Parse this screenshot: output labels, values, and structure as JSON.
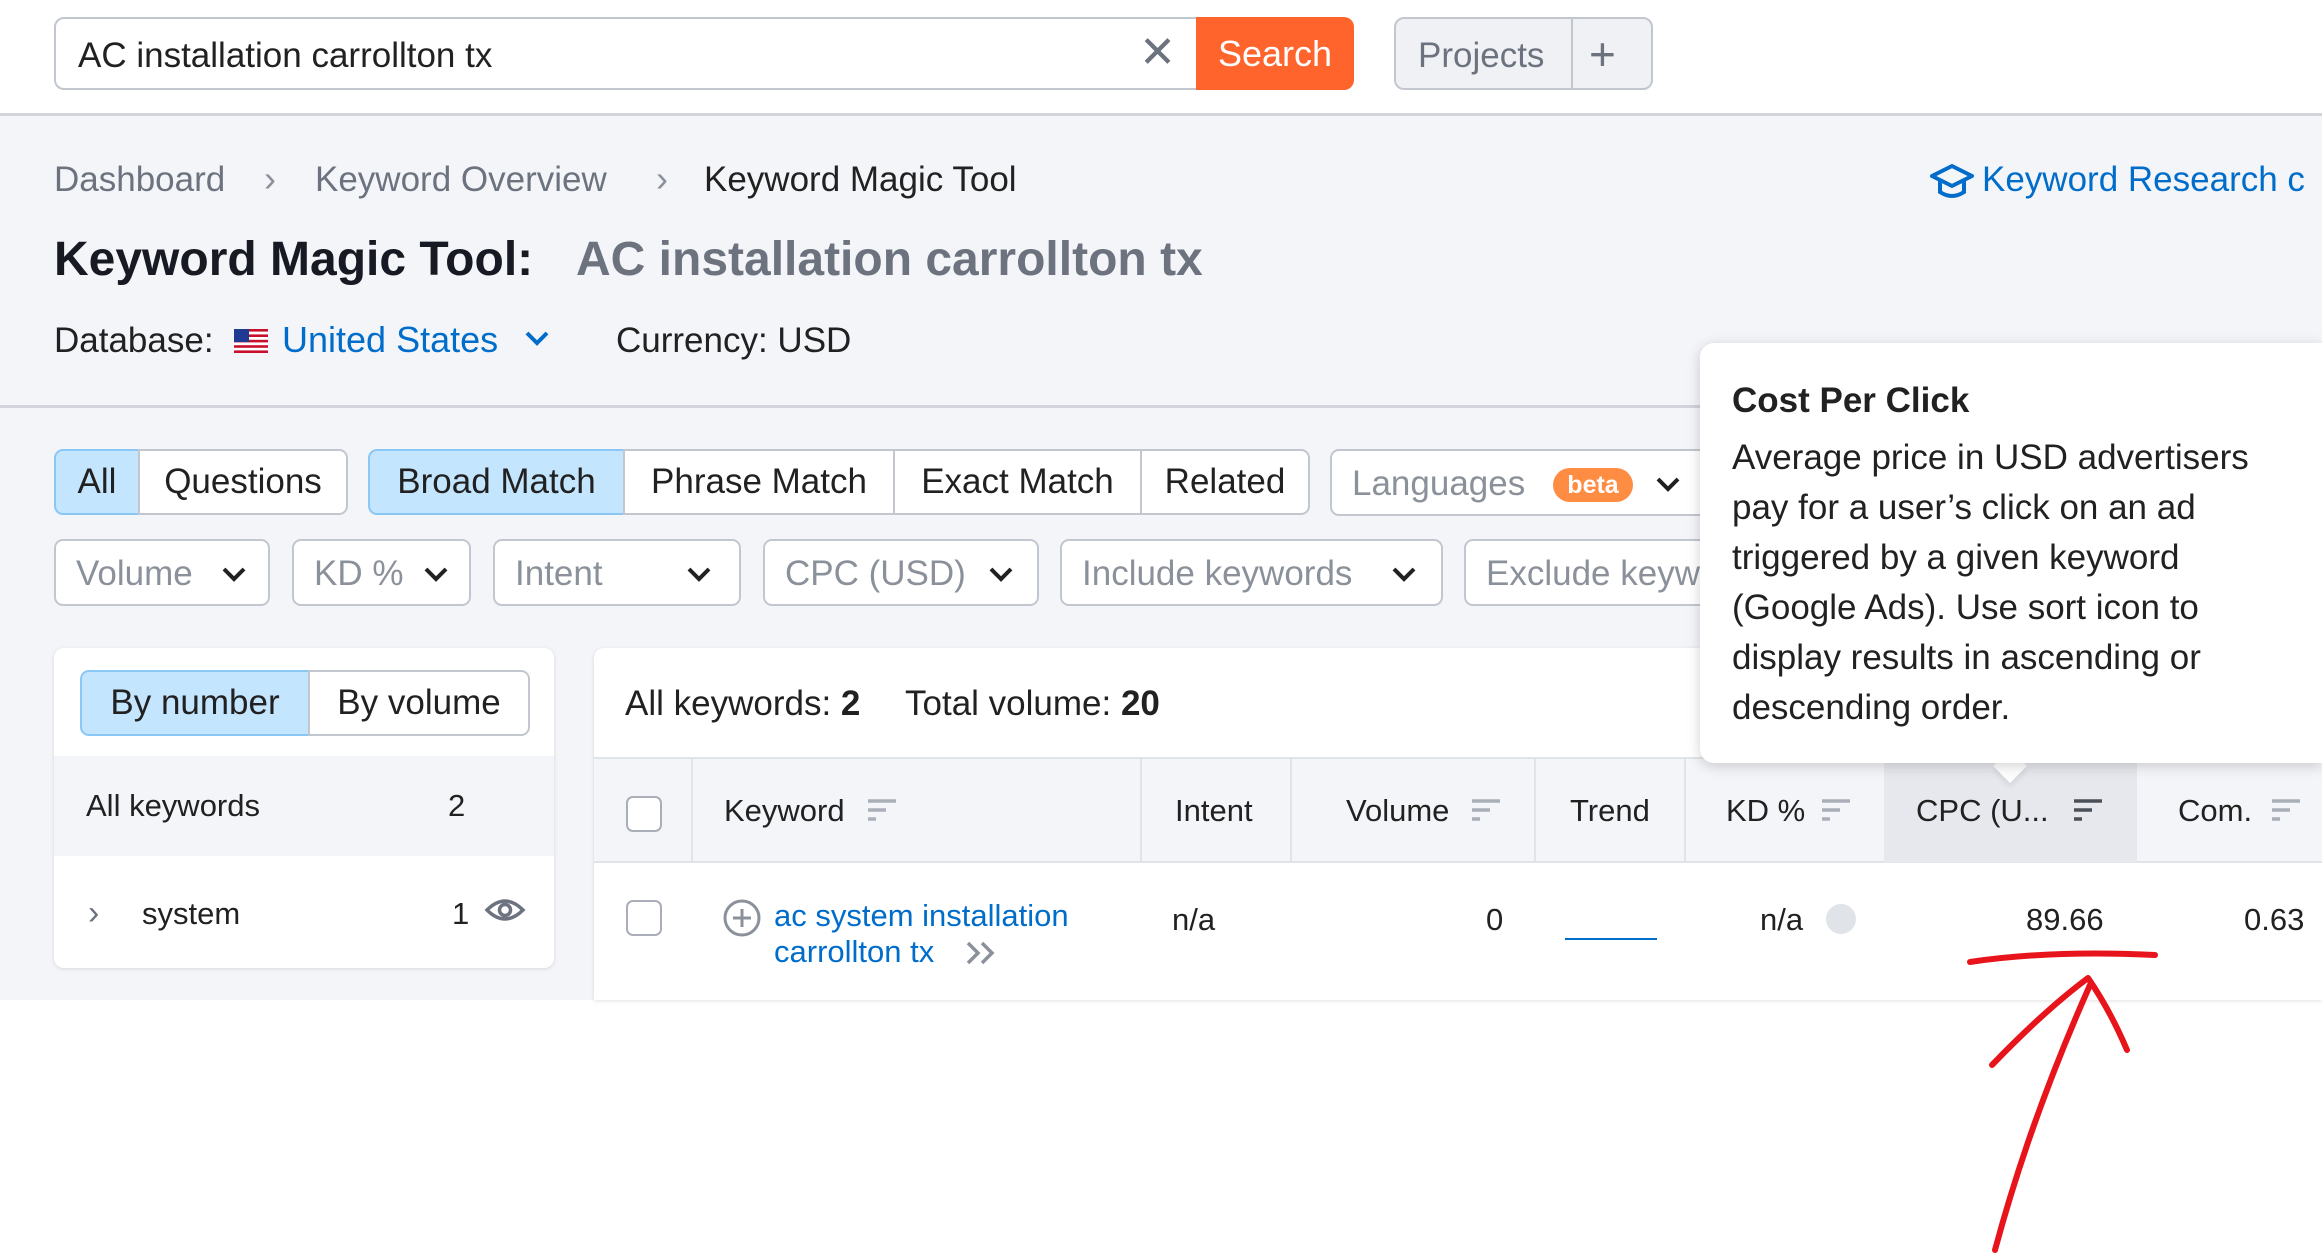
{
  "search": {
    "query": "AC installation carrollton tx",
    "button": "Search",
    "clear_icon": "close-icon"
  },
  "projects": {
    "label": "Projects",
    "add": "+"
  },
  "breadcrumb": [
    "Dashboard",
    "Keyword Overview",
    "Keyword Magic Tool"
  ],
  "research_link": "Keyword Research c",
  "title": {
    "tool": "Keyword Magic Tool:",
    "query": "AC installation carrollton tx"
  },
  "database": {
    "label": "Database:",
    "value": "United States",
    "currency": "Currency: USD"
  },
  "filters_row1": {
    "all": "All",
    "questions": "Questions",
    "broad": "Broad Match",
    "phrase": "Phrase Match",
    "exact": "Exact Match",
    "related": "Related",
    "languages": "Languages",
    "beta": "beta"
  },
  "filters_row2": [
    "Volume",
    "KD %",
    "Intent",
    "CPC (USD)",
    "Include keywords",
    "Exclude keyw"
  ],
  "left_panel": {
    "by_number": "By number",
    "by_volume": "By volume",
    "all_keywords": "All keywords",
    "all_count": "2",
    "group": "system",
    "group_count": "1"
  },
  "summary": {
    "all_label": "All keywords:",
    "all_value": "2",
    "vol_label": "Total volume:",
    "vol_value": "20"
  },
  "table": {
    "headers": {
      "keyword": "Keyword",
      "intent": "Intent",
      "volume": "Volume",
      "trend": "Trend",
      "kd": "KD %",
      "cpc": "CPC (U...",
      "com": "Com."
    },
    "row": {
      "keyword_line1": "ac system installation",
      "keyword_line2": "carrollton tx",
      "intent": "n/a",
      "volume": "0",
      "kd": "n/a",
      "cpc": "89.66",
      "com": "0.63"
    }
  },
  "tooltip": {
    "title": "Cost Per Click",
    "body": "Average price in USD advertisers pay for a user’s click on an ad triggered by a given keyword (Google Ads). Use sort icon to display results in ascending or descending order."
  },
  "colors": {
    "accent": "#ff642d",
    "link": "#006dca",
    "active_bg": "#c4e5fe",
    "annotation": "#e8141b"
  }
}
